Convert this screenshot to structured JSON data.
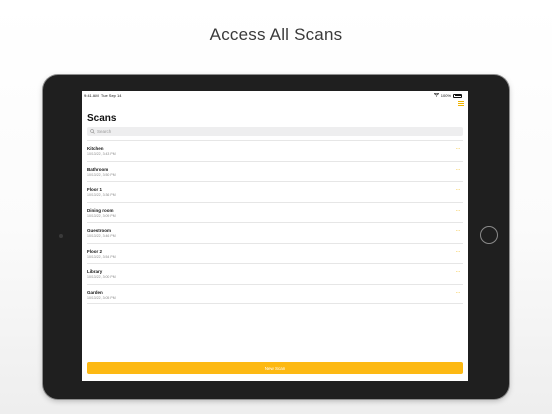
{
  "headline": "Access All Scans",
  "status_bar": {
    "time": "9:41 AM",
    "date": "Tue Sep 14",
    "battery": "100%"
  },
  "screen": {
    "title": "Scans",
    "search": {
      "placeholder": "Search"
    },
    "scans": [
      {
        "name": "Kitchen",
        "date": "10/13/22, 3:43 PM"
      },
      {
        "name": "Bathroom",
        "date": "10/13/22, 3:50 PM"
      },
      {
        "name": "Floor 1",
        "date": "10/13/22, 3:36 PM"
      },
      {
        "name": "Dining room",
        "date": "10/13/22, 3:09 PM"
      },
      {
        "name": "Guestroom",
        "date": "10/13/22, 3:46 PM"
      },
      {
        "name": "Floor 2",
        "date": "10/13/22, 3:54 PM"
      },
      {
        "name": "Library",
        "date": "10/13/22, 3:00 PM"
      },
      {
        "name": "Garden",
        "date": "10/13/22, 3:05 PM"
      }
    ],
    "more_label": "···",
    "new_scan_label": "New Scan"
  },
  "icons": {
    "menu": "hamburger-menu-icon",
    "search": "search-icon",
    "wifi": "wifi-icon",
    "battery": "battery-icon",
    "more": "ellipsis-icon"
  },
  "colors": {
    "accent": "#fdb913",
    "device_bezel": "#1f1f1f"
  }
}
